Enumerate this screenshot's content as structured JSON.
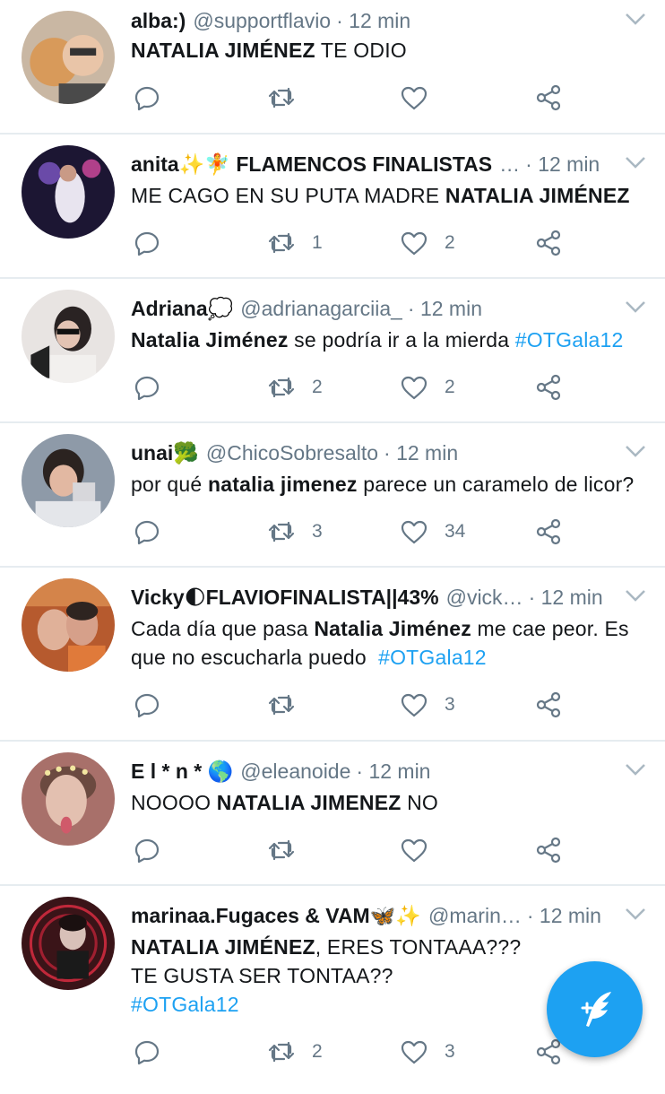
{
  "tweets": [
    {
      "name": "alba:)",
      "handle": "@supportflavio",
      "time": "· 12 min",
      "body_html": "<b>NATALIA JIMÉNEZ</b> TE ODIO",
      "retweets": "",
      "likes": ""
    },
    {
      "name": "anita✨🧚 FLAMENCOS FINALISTAS",
      "handle": "…",
      "time": "· 12 min",
      "body_html": "ME CAGO EN SU PUTA MADRE <b>NATALIA JIMÉNEZ</b>",
      "retweets": "1",
      "likes": "2"
    },
    {
      "name": "Adriana💭",
      "handle": "@adrianagarciia_",
      "time": "· 12 min",
      "body_html": "<b>Natalia Jiménez</b> se podría ir a la mierda <span class='hashtag'>#OTGala12</span>",
      "retweets": "2",
      "likes": "2"
    },
    {
      "name": "unai🥦",
      "handle": "@ChicoSobresalto",
      "time": "· 12 min",
      "body_html": "por qué <b>natalia jimenez</b> parece un caramelo de licor?",
      "retweets": "3",
      "likes": "34"
    },
    {
      "name": "Vicky🌓FLAVIOFINALISTA||43%",
      "handle": "@vick…",
      "time": "· 12 min",
      "body_html": "Cada día que pasa <b>Natalia Jiménez</b> me cae peor. Es que no escucharla puedo &nbsp;<span class='hashtag'>#OTGala12</span>",
      "retweets": "",
      "likes": "3"
    },
    {
      "name": "E l * n * 🌎",
      "handle": "@eleanoide",
      "time": "· 12 min",
      "body_html": "NOOOO <b>NATALIA JIMENEZ</b> NO",
      "retweets": "",
      "likes": ""
    },
    {
      "name": "marinaa.Fugaces & VAM🦋✨",
      "handle": "@marin…",
      "time": "· 12 min",
      "body_html": "<b>NATALIA JIMÉNEZ</b>, ERES TONTAAA???<br>TE GUSTA SER TONTAA??<br><span class='hashtag'>#OTGala12</span>",
      "retweets": "2",
      "likes": "3"
    }
  ],
  "colors": {
    "accent": "#1da1f2",
    "secondary_text": "#657786",
    "divider": "#e6ecf0"
  },
  "icons": {
    "reply": "reply-icon",
    "retweet": "retweet-icon",
    "like": "heart-icon",
    "share": "share-icon",
    "menu": "chevron-down-icon",
    "compose": "compose-tweet-icon"
  }
}
